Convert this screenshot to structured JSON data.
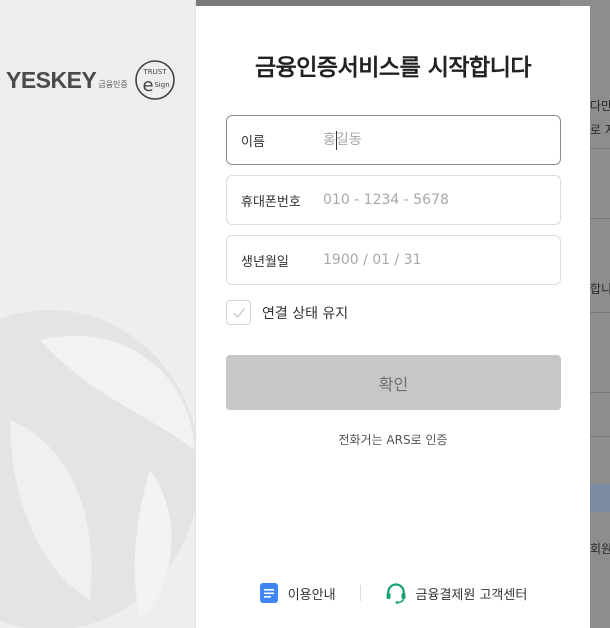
{
  "brand": {
    "wordmark": "YESKEY",
    "wordmark_sub": "금융인증",
    "trust_top": "TRUST",
    "trust_bottom": "Sign",
    "trust_letter": "e"
  },
  "modal": {
    "title": "금융인증서비스를 시작합니다",
    "fields": [
      {
        "label": "이름",
        "placeholder": "홍길동",
        "value": ""
      },
      {
        "label": "휴대폰번호",
        "placeholder": "010 - 1234 - 5678",
        "value": ""
      },
      {
        "label": "생년월일",
        "placeholder": "1900 / 01 / 31",
        "value": ""
      }
    ],
    "keep_login": {
      "label": "연결 상태 유지",
      "checked": false
    },
    "confirm_label": "확인",
    "ars_link": "전화거는 ARS로 인증",
    "footer": {
      "guide_label": "이용안내",
      "support_label": "금융결제원 고객센터"
    }
  },
  "background_page": {
    "snippets": [
      "다만",
      "로 지",
      "합니",
      "회원"
    ]
  },
  "colors": {
    "guide_icon": "#3f86f4",
    "support_icon": "#1aa37a",
    "confirm_bg": "#c7c7c7",
    "title": "#222222"
  }
}
